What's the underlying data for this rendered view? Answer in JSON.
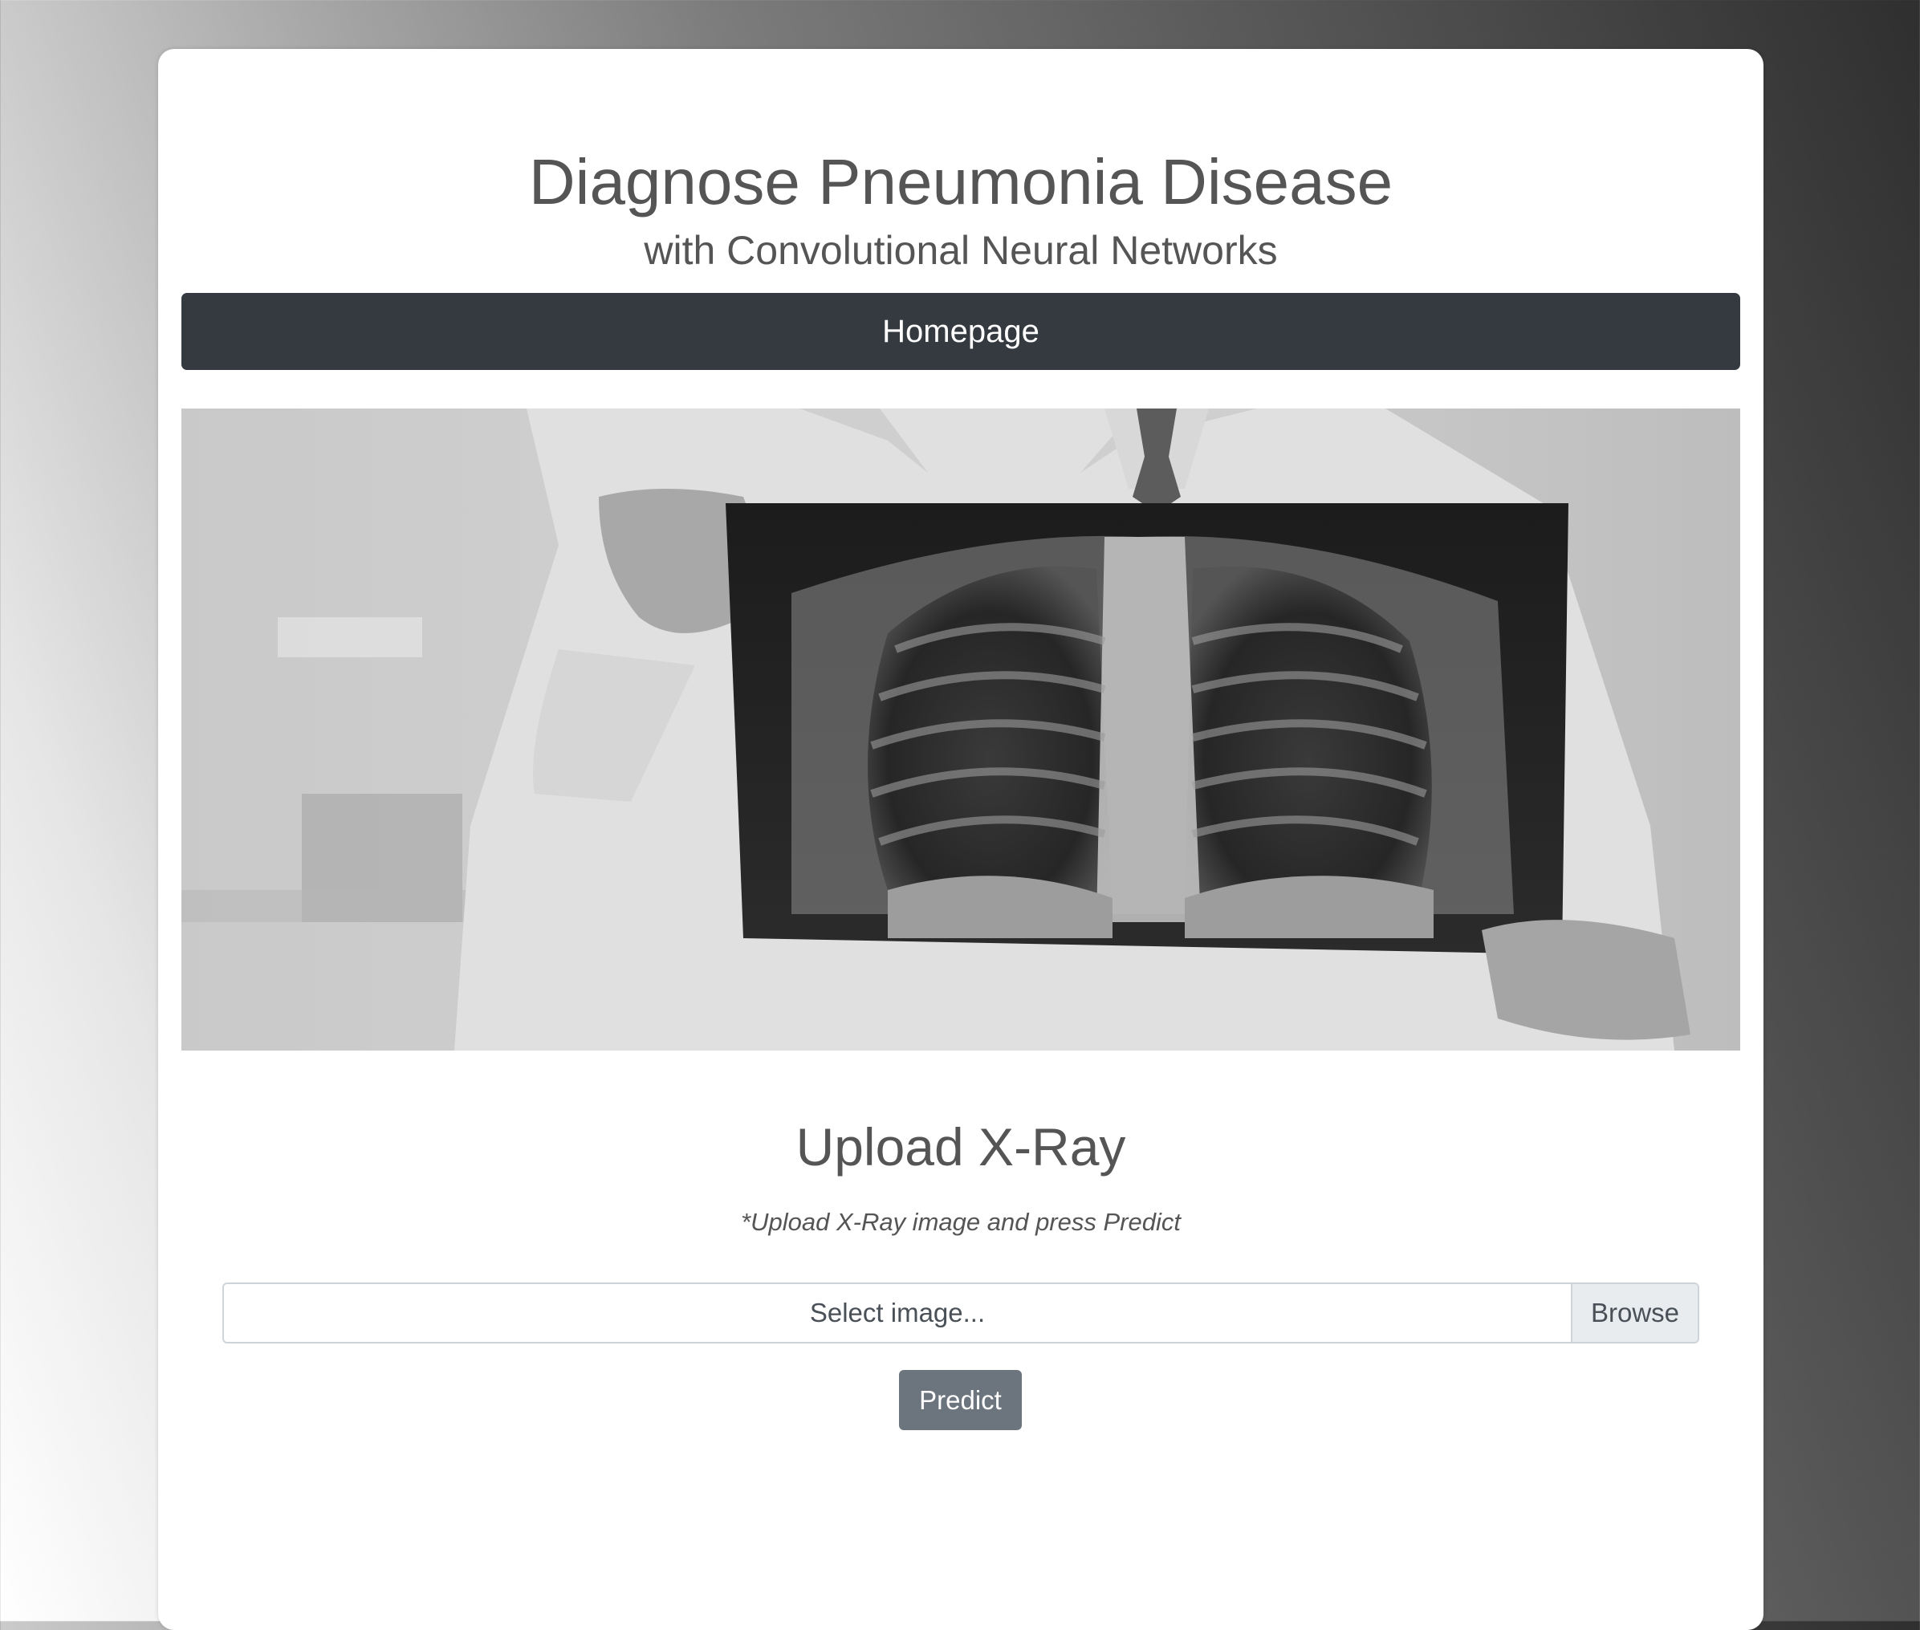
{
  "header": {
    "title": "Diagnose Pneumonia Disease",
    "subtitle": "with Convolutional Neural Networks"
  },
  "nav": {
    "home_link": "Homepage"
  },
  "hero": {
    "image_description_icon": "doctor-holding-chest-xray-image"
  },
  "upload": {
    "heading": "Upload X-Ray",
    "hint": "*Upload X-Ray image and press Predict",
    "file_placeholder": "Select image...",
    "browse_label": "Browse",
    "predict_label": "Predict"
  },
  "colors": {
    "navbar": "#343a40",
    "predict_button": "#6c757d",
    "text": "#555555"
  }
}
